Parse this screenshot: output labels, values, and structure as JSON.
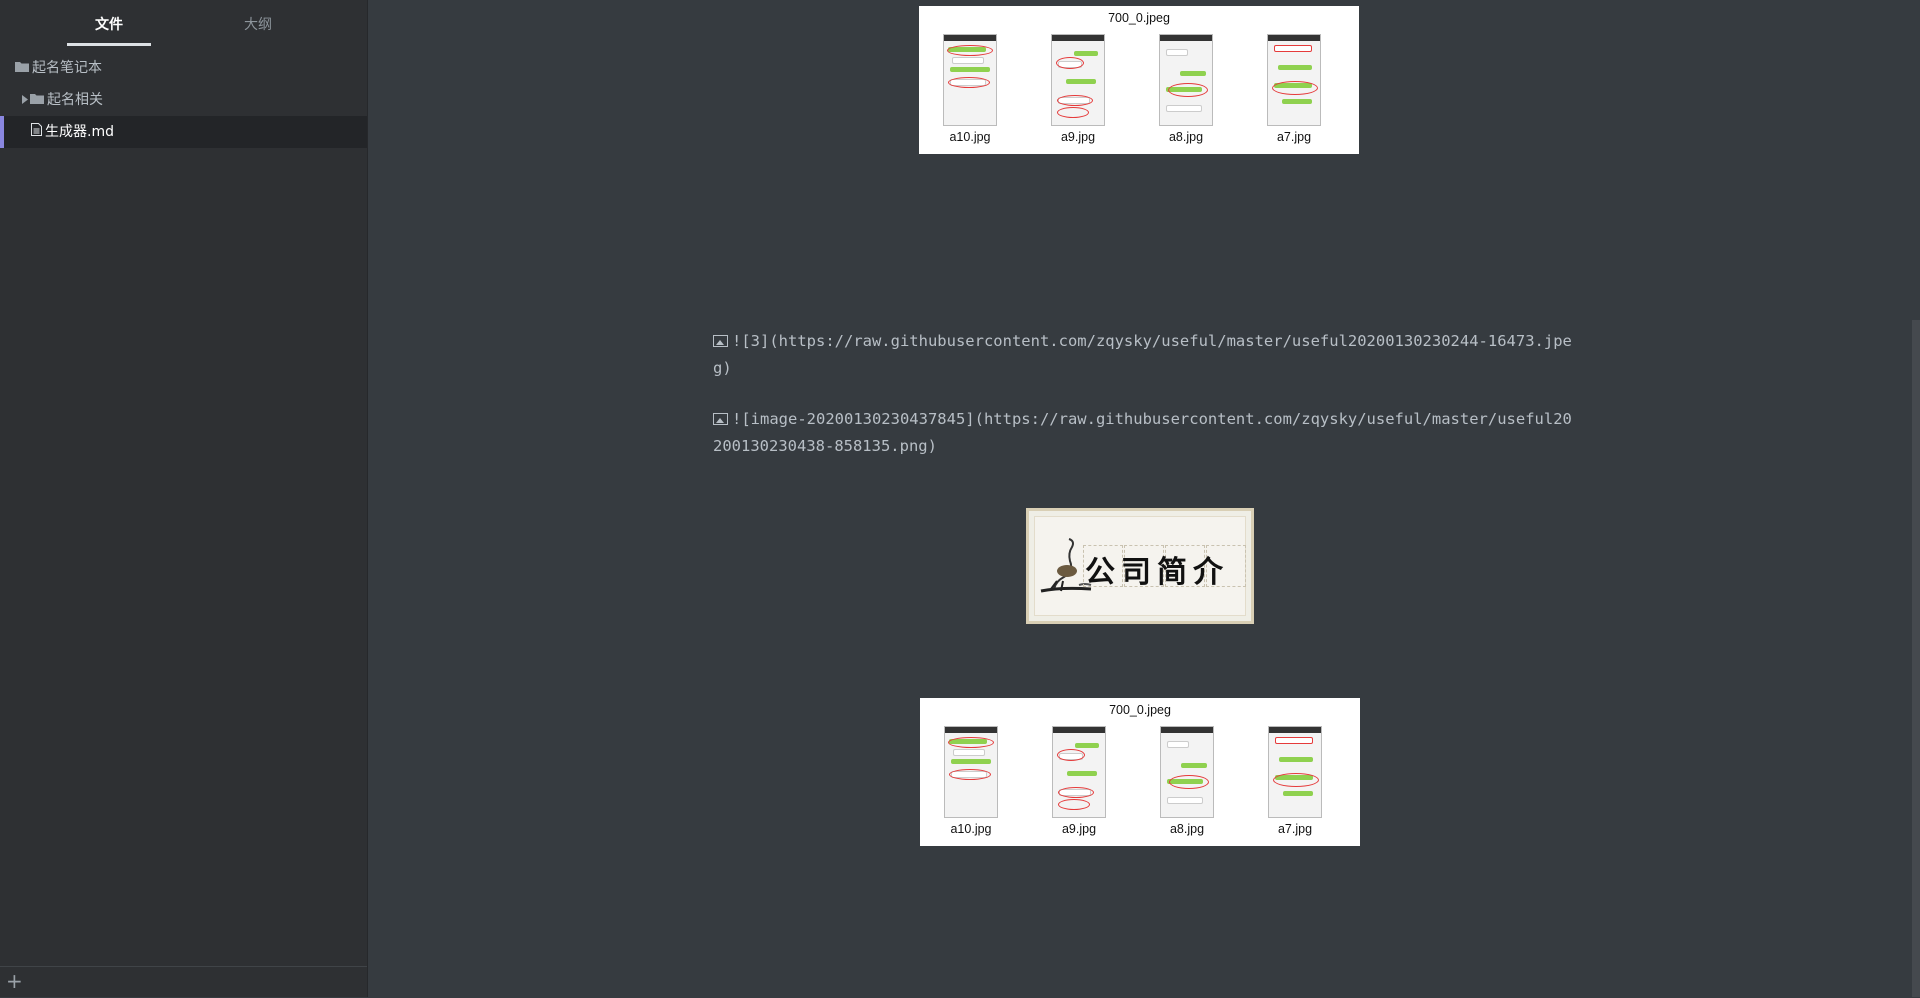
{
  "sidebar": {
    "tabs": [
      {
        "label": "文件",
        "active": true
      },
      {
        "label": "大纲",
        "active": false
      }
    ],
    "tree": [
      {
        "label": "起名笔记本",
        "icon": "folder-icon",
        "depth": 0
      },
      {
        "label": "起名相关",
        "icon": "folder-icon",
        "depth": 1,
        "collapsed": true
      },
      {
        "label": "生成器.md",
        "icon": "file-icon",
        "depth": 1,
        "selected": true
      }
    ],
    "add_label": "+"
  },
  "editor": {
    "panel_top": {
      "title": "700_0.jpeg",
      "thumbs": [
        "a10.jpg",
        "a9.jpg",
        "a8.jpg",
        "a7.jpg"
      ]
    },
    "md_line_1": "![3](https://raw.githubusercontent.com/zqysky/useful/master/useful20200130230244-16473.jpeg)",
    "md_line_2": "![image-20200130230437845](https://raw.githubusercontent.com/zqysky/useful/master/useful20200130230438-858135.png)",
    "banner_text": "公司简介",
    "panel_bottom": {
      "title": "700_0.jpeg",
      "thumbs": [
        "a10.jpg",
        "a9.jpg",
        "a8.jpg",
        "a7.jpg"
      ]
    }
  },
  "colors": {
    "background": "#363b40",
    "sidebar": "#2e3033",
    "accent": "#8a87e0"
  }
}
